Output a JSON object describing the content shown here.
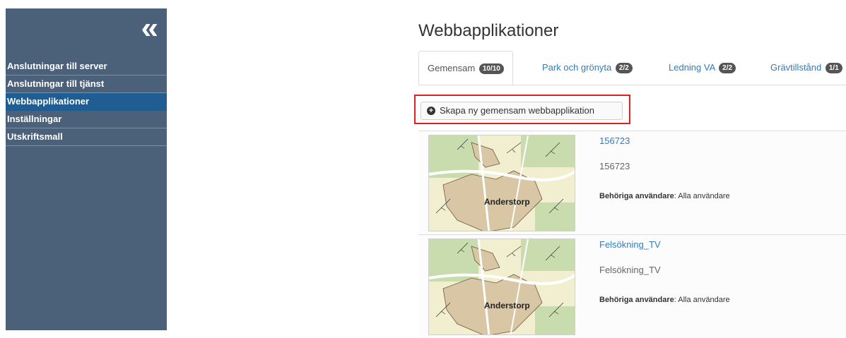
{
  "sidebar": {
    "collapse_glyph": "«",
    "items": [
      {
        "label": "Anslutningar till server",
        "active": false
      },
      {
        "label": "Anslutningar till tjänst",
        "active": false
      },
      {
        "label": "Webbapplikationer",
        "active": true
      },
      {
        "label": "Inställningar",
        "active": false
      },
      {
        "label": "Utskriftsmall",
        "active": false
      }
    ]
  },
  "main": {
    "title": "Webbapplikationer",
    "tabs": [
      {
        "label": "Gemensam",
        "badge": "10/10",
        "active": true
      },
      {
        "label": "Park och grönyta",
        "badge": "2/2",
        "active": false
      },
      {
        "label": "Ledning VA",
        "badge": "2/2",
        "active": false
      },
      {
        "label": "Grävtillstånd",
        "badge": "1/1",
        "active": false
      }
    ],
    "create_button": {
      "label": "Skapa ny gemensam webbapplikation",
      "icon": "plus-circle-icon"
    },
    "apps": [
      {
        "name": "156723",
        "description": "156723",
        "users_label": "Behöriga användare",
        "users_value": ": Alla användare",
        "map_label": "Anderstorp"
      },
      {
        "name": "Felsökning_TV",
        "description": "Felsökning_TV",
        "users_label": "Behöriga användare",
        "users_value": ": Alla användare",
        "map_label": "Anderstorp"
      }
    ]
  },
  "colors": {
    "sidebar_bg": "#4b6079",
    "sidebar_active": "#1f5d92",
    "link": "#2d7ec2",
    "highlight_border": "#e02020"
  }
}
